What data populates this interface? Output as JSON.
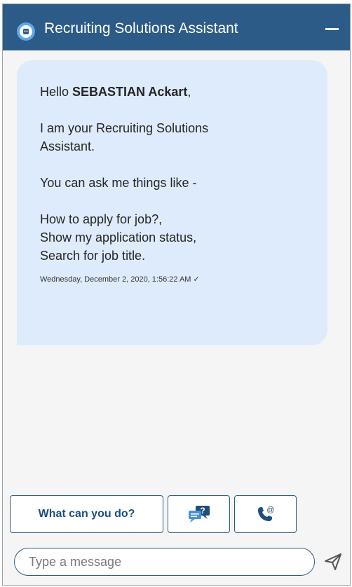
{
  "header": {
    "title": "Recruiting Solutions Assistant",
    "bot_icon": "bot-headset-icon",
    "minimize_icon": "minimize-icon",
    "bg_color": "#2d5b88"
  },
  "message": {
    "greeting_prefix": "Hello ",
    "user_name": "SEBASTIAN Ackart",
    "greeting_suffix": ",",
    "intro": "I am your Recruiting Solutions Assistant.",
    "ask": "You can ask me things like -",
    "examples": [
      "How to apply for job?,",
      "Show my application status,",
      "Search for job title."
    ],
    "timestamp": "Wednesday, December 2, 2020, 1:56:22 AM ✓",
    "bubble_color": "#deebfc"
  },
  "quick_actions": {
    "what_can_you_do": "What can you do?",
    "faq_icon": "faq-chat-icon",
    "contact_icon": "phone-email-icon"
  },
  "composer": {
    "placeholder": "Type a message",
    "send_icon": "send-icon"
  }
}
